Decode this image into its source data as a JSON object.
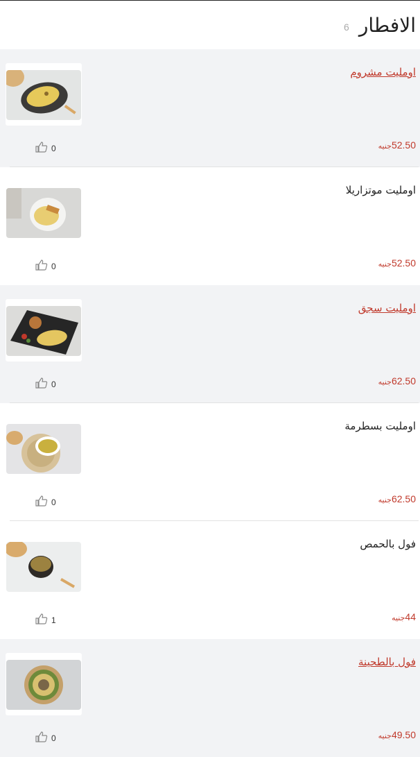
{
  "category": {
    "title": "الافطار",
    "count": "6"
  },
  "items": [
    {
      "name": "اومليت مشروم",
      "price": "52.50",
      "currency": "جنيه",
      "likes": "0",
      "link": true,
      "icon": "like-icon"
    },
    {
      "name": "اومليت موتزاريلا",
      "price": "52.50",
      "currency": "جنيه",
      "likes": "0",
      "link": false,
      "icon": "like-icon"
    },
    {
      "name": "اومليت سجق",
      "price": "62.50",
      "currency": "جنيه",
      "likes": "0",
      "link": true,
      "icon": "like-icon"
    },
    {
      "name": "اومليت بسطرمة",
      "price": "62.50",
      "currency": "جنيه",
      "likes": "0",
      "link": false,
      "icon": "like-icon"
    },
    {
      "name": "فول بالحمص",
      "price": "44",
      "currency": "جنيه",
      "likes": "1",
      "link": false,
      "icon": "like-icon"
    },
    {
      "name": "فول بالطحينة",
      "price": "49.50",
      "currency": "جنيه",
      "likes": "0",
      "link": true,
      "icon": "like-icon"
    }
  ],
  "colors": {
    "accent": "#c0392b",
    "shaded_row": "#f2f3f5"
  }
}
